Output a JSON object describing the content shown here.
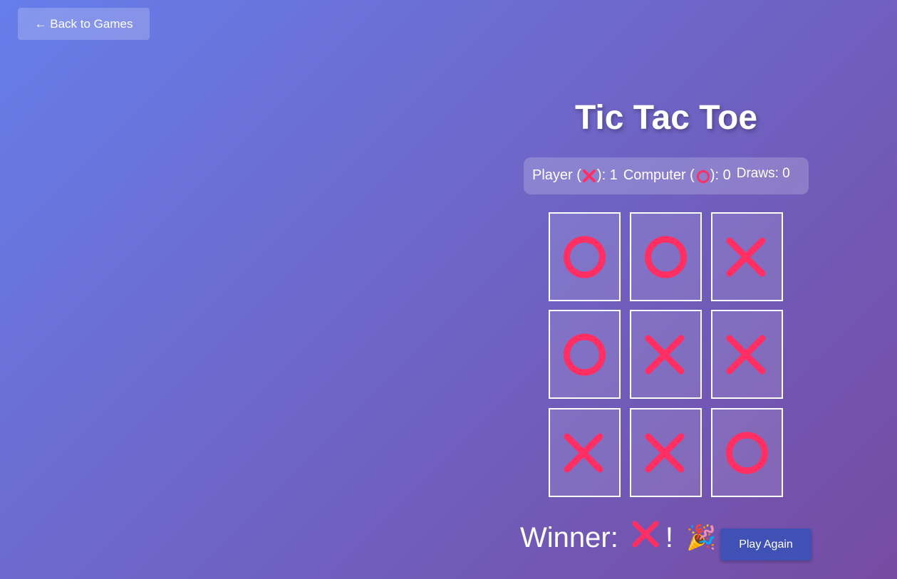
{
  "nav": {
    "back_label": "← Back to Games"
  },
  "game": {
    "title": "Tic Tac Toe"
  },
  "scoreboard": {
    "player_label": "Player (",
    "player_suffix": "): 1",
    "computer_label": "Computer (",
    "computer_suffix": "): 0",
    "draws": "Draws: 0"
  },
  "board": [
    "O",
    "O",
    "X",
    "O",
    "X",
    "X",
    "X",
    "X",
    "O"
  ],
  "status": {
    "winner_prefix": "Winner: ",
    "winner_suffix": "!",
    "party_emoji": "🎉"
  },
  "actions": {
    "play_again_label": "Play Again"
  },
  "colors": {
    "mark": "#ff2e63",
    "accent_button": "#3f51b5"
  },
  "icons": {
    "player_mark": "x-mark-icon",
    "computer_mark": "o-mark-icon",
    "celebration": "party-popper-icon"
  }
}
